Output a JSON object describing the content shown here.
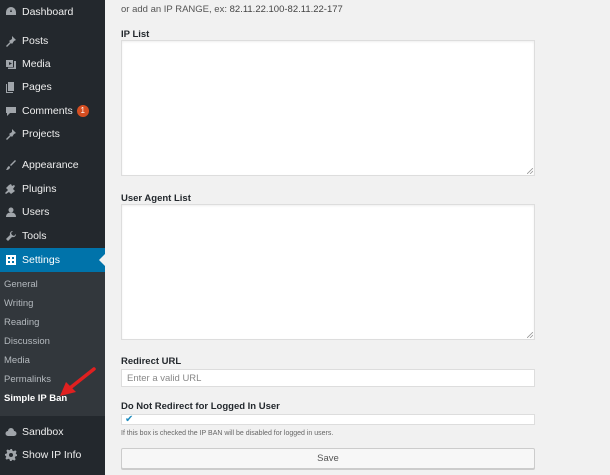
{
  "sidebar": {
    "items": [
      {
        "label": "Dashboard",
        "icon": "dashboard-icon"
      },
      {
        "label": "Posts",
        "icon": "pin-icon"
      },
      {
        "label": "Media",
        "icon": "media-icon"
      },
      {
        "label": "Pages",
        "icon": "pages-icon"
      },
      {
        "label": "Comments",
        "icon": "comment-icon",
        "badge": "1"
      },
      {
        "label": "Projects",
        "icon": "pin-icon"
      },
      {
        "label": "Appearance",
        "icon": "brush-icon"
      },
      {
        "label": "Plugins",
        "icon": "plugin-icon"
      },
      {
        "label": "Users",
        "icon": "user-icon"
      },
      {
        "label": "Tools",
        "icon": "wrench-icon"
      },
      {
        "label": "Settings",
        "icon": "settings-icon",
        "active": true
      },
      {
        "label": "Sandbox",
        "icon": "cloud-icon"
      },
      {
        "label": "Show IP Info",
        "icon": "gear-icon"
      }
    ],
    "submenu": [
      {
        "label": "General"
      },
      {
        "label": "Writing"
      },
      {
        "label": "Reading"
      },
      {
        "label": "Discussion"
      },
      {
        "label": "Media"
      },
      {
        "label": "Permalinks"
      },
      {
        "label": "Simple IP Ban",
        "current": true
      }
    ]
  },
  "content": {
    "hint_prefix": "or add an IP RANGE, ex:",
    "hint_example": "82.11.22.100-82.11.22-177",
    "ip_list_label": "IP List",
    "user_agent_label": "User Agent List",
    "redirect_label": "Redirect URL",
    "redirect_placeholder": "Enter a valid URL",
    "no_redirect_label": "Do Not Redirect for Logged In User",
    "no_redirect_checked": true,
    "checkbox_desc": "If this box is checked the IP BAN will be disabled for logged in users.",
    "save_label": "Save"
  },
  "colors": {
    "sidebar_bg": "#23282d",
    "submenu_bg": "#32373c",
    "active_bg": "#0073aa",
    "badge_bg": "#d54e21",
    "annotation_arrow": "#e02020"
  }
}
